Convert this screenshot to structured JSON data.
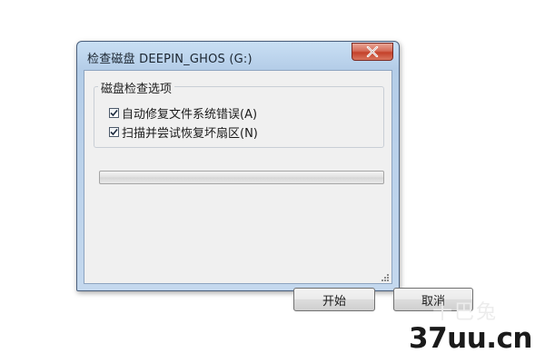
{
  "window": {
    "title": "检查磁盘 DEEPIN_GHOS (G:)"
  },
  "options_group": {
    "legend": "磁盘检查选项",
    "options": [
      {
        "label": "自动修复文件系统错误(A)",
        "checked": true
      },
      {
        "label": "扫描并尝试恢复坏扇区(N)",
        "checked": true
      }
    ]
  },
  "progress": {
    "value": 0
  },
  "buttons": {
    "start_label": "开始",
    "cancel_label": "取消"
  },
  "watermark": {
    "chinese": "十巴兔",
    "domain": "37uu.cn"
  },
  "colors": {
    "title_bar": "#b4cde8",
    "close_button": "#c4412a",
    "client_background": "#f0f0f0"
  },
  "icons": {
    "close": "close-icon",
    "checkmark": "checkmark-icon",
    "resize_grip": "resize-grip-icon"
  }
}
